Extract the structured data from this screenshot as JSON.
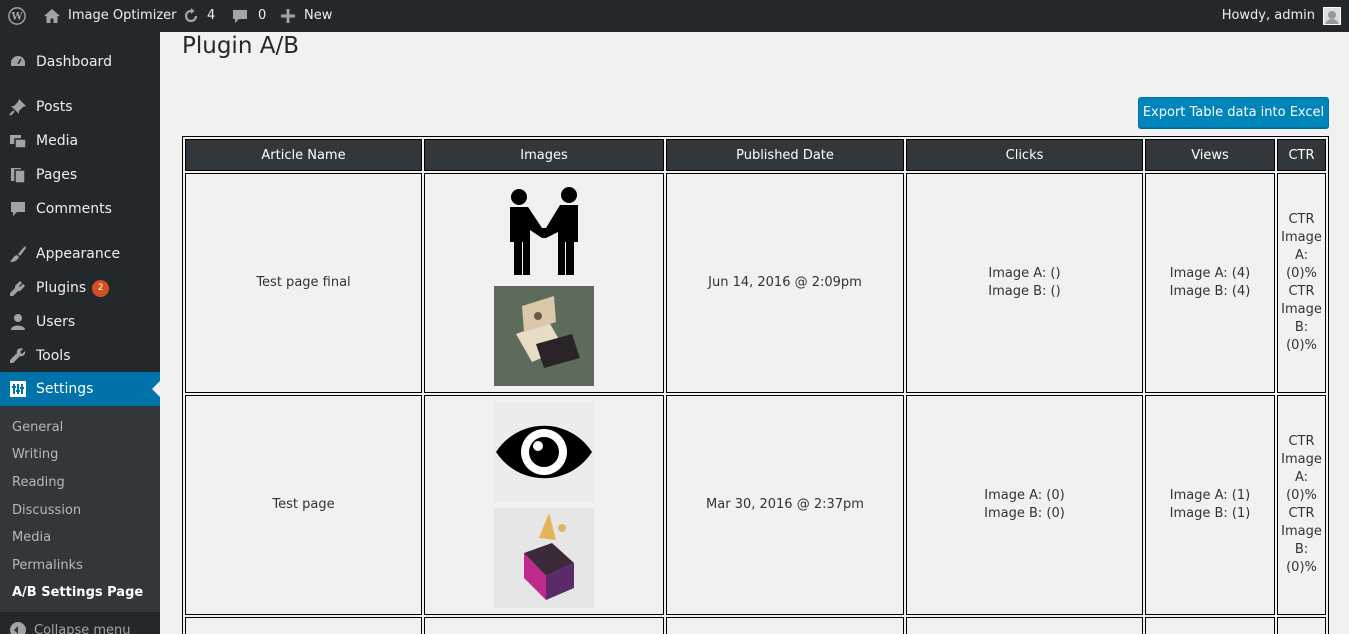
{
  "adminbar": {
    "wp_logo": "wordpress-icon",
    "site_name": "Image Optimizer",
    "updates_count": "4",
    "comments_count": "0",
    "new_label": "New",
    "howdy": "Howdy, admin"
  },
  "sidebar": {
    "items": [
      {
        "label": "Dashboard",
        "icon": "dashboard-icon"
      },
      {
        "label": "Posts",
        "icon": "pin-icon"
      },
      {
        "label": "Media",
        "icon": "media-icon"
      },
      {
        "label": "Pages",
        "icon": "pages-icon"
      },
      {
        "label": "Comments",
        "icon": "comments-icon"
      },
      {
        "label": "Appearance",
        "icon": "brush-icon"
      },
      {
        "label": "Plugins",
        "icon": "plugin-icon",
        "badge": "2"
      },
      {
        "label": "Users",
        "icon": "users-icon"
      },
      {
        "label": "Tools",
        "icon": "wrench-icon"
      },
      {
        "label": "Settings",
        "icon": "settings-icon",
        "current": true
      }
    ],
    "submenu": [
      "General",
      "Writing",
      "Reading",
      "Discussion",
      "Media",
      "Permalinks",
      "A/B Settings Page"
    ],
    "collapse_label": "Collapse menu"
  },
  "page": {
    "title": "Plugin A/B",
    "export_button": "Export Table data into Excel"
  },
  "table": {
    "headers": [
      "Article Name",
      "Images",
      "Published Date",
      "Clicks",
      "Views",
      "CTR"
    ],
    "rows": [
      {
        "article": "Test page final",
        "images": [
          "handshake-people-image",
          "gift-box-photo"
        ],
        "date": "Jun 14, 2016 @ 2:09pm",
        "clicks_a": "Image A: ()",
        "clicks_b": "Image B: ()",
        "views_a": "Image A: (4)",
        "views_b": "Image B: (4)",
        "ctr": [
          "CTR",
          "Image",
          "A:",
          "(0)%",
          "CTR",
          "Image",
          "B:",
          "(0)%"
        ]
      },
      {
        "article": "Test page",
        "images": [
          "eye-image",
          "purple-cube-art"
        ],
        "date": "Mar 30, 2016 @ 2:37pm",
        "clicks_a": "Image A: (0)",
        "clicks_b": "Image B: (0)",
        "views_a": "Image A: (1)",
        "views_b": "Image B: (1)",
        "ctr": [
          "CTR",
          "Image",
          "A:",
          "(0)%",
          "CTR",
          "Image",
          "B:",
          "(0)%"
        ]
      }
    ]
  },
  "colors": {
    "admin_dark": "#23282d",
    "submenu_bg": "#32373c",
    "accent_blue": "#0073aa",
    "button_blue": "#0085ba",
    "badge_orange": "#d54e21"
  }
}
